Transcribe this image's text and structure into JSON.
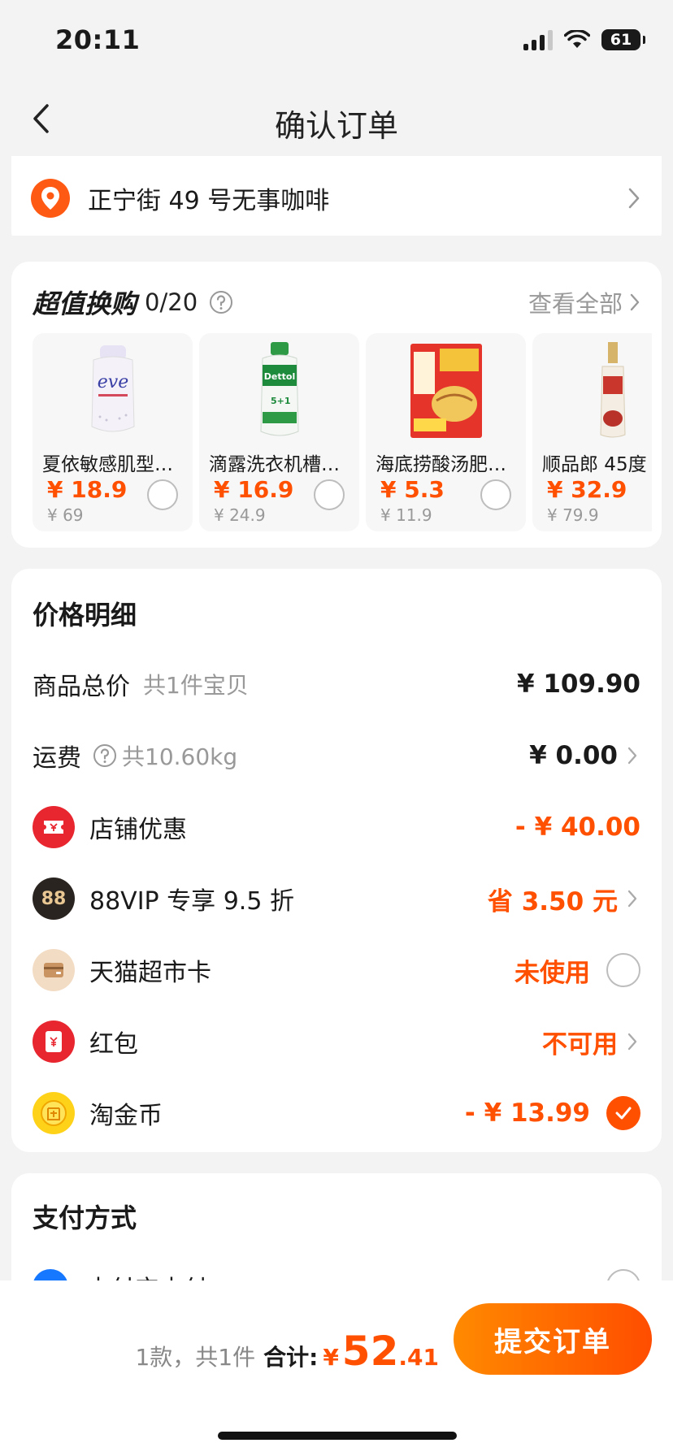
{
  "status": {
    "time": "20:11",
    "battery": "61"
  },
  "header": {
    "title": "确认订单"
  },
  "address": {
    "text": "正宁街 49 号无事咖啡"
  },
  "exchange": {
    "title": "超值换购",
    "count": "0/20",
    "view_all": "查看全部",
    "products": [
      {
        "name": "夏依敏感肌型护理液",
        "price": "¥ 18.9",
        "original": "¥ 69"
      },
      {
        "name": "滴露洗衣机槽清洁剂",
        "price": "¥ 16.9",
        "original": "¥ 24.9"
      },
      {
        "name": "海底捞酸汤肥牛调味料",
        "price": "¥ 5.3",
        "original": "¥ 11.9"
      },
      {
        "name": "顺品郎 45度",
        "price": "¥ 32.9",
        "original": "¥ 79.9"
      }
    ]
  },
  "price_detail": {
    "title": "价格明细",
    "goods_total": {
      "label": "商品总价",
      "sub": "共1件宝贝",
      "value": "¥ 109.90"
    },
    "shipping": {
      "label": "运费",
      "sub": "共10.60kg",
      "value": "¥ 0.00"
    },
    "shop_discount": {
      "label": "店铺优惠",
      "value": "- ¥ 40.00"
    },
    "vip": {
      "label": "88VIP 专享 9.5 折",
      "value": "省 3.50 元",
      "icon_text": "88"
    },
    "tmall_card": {
      "label": "天猫超市卡",
      "value": "未使用"
    },
    "red_packet": {
      "label": "红包",
      "value": "不可用"
    },
    "coins": {
      "label": "淘金币",
      "value": "- ¥ 13.99"
    }
  },
  "payment": {
    "title": "支付方式",
    "first_option": "支付宝支付"
  },
  "bottom": {
    "count": "1款，共1件",
    "total_label": "合计:",
    "yen": "¥",
    "total_int": "52",
    "total_dec": ".41",
    "submit": "提交订单"
  },
  "colors": {
    "accent": "#ff5000",
    "background": "#f3f3f3"
  }
}
